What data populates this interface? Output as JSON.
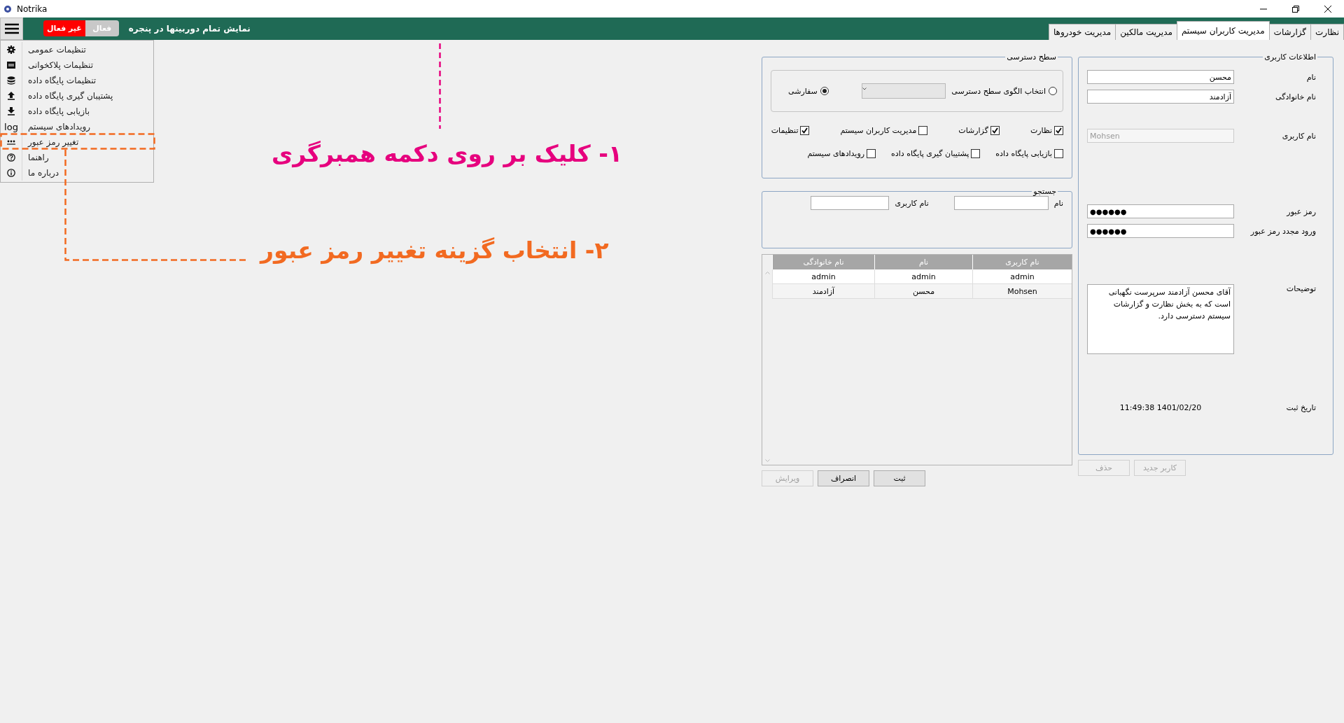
{
  "window": {
    "title": "Notrika"
  },
  "toolbar": {
    "toggle": [
      {
        "label": "فعال",
        "selected": false
      },
      {
        "label": "غیر فعال",
        "selected": true
      }
    ],
    "label": "نمایش تمام دوربینها در پنجره"
  },
  "tabs": [
    {
      "label": "نظارت",
      "selected": false
    },
    {
      "label": "گزارشات",
      "selected": false
    },
    {
      "label": "مدیریت کاربران سیستم",
      "selected": true
    },
    {
      "label": "مدیریت مالکین",
      "selected": false
    },
    {
      "label": "مدیریت خودروها",
      "selected": false
    }
  ],
  "menu": {
    "expanded": true,
    "items": [
      {
        "kind": "settings",
        "label": "تنظیمات عمومی"
      },
      {
        "kind": "plate",
        "label": "تنظیمات پلاکخوانی"
      },
      {
        "kind": "database",
        "label": "تنظیمات پایگاه داده"
      },
      {
        "kind": "upload",
        "label": "پشتیبان گیری پایگاه داده"
      },
      {
        "kind": "download",
        "label": "بازیابی پایگاه داده"
      },
      {
        "kind": "log",
        "icon_text": "log",
        "label": "رویدادهای سیستم"
      },
      {
        "kind": "password",
        "label": "تغییر رمز عبور"
      },
      {
        "kind": "help",
        "label": "راهنما"
      },
      {
        "kind": "info",
        "label": "درباره ما"
      }
    ]
  },
  "annotations": [
    {
      "text": "۱- کلیک بر روی دکمه همبرگری",
      "color": "#e6007e"
    },
    {
      "text": "۲- انتخاب گزینه تغییر رمز عبور",
      "color": "#f26a21"
    }
  ],
  "user_info": {
    "title": "اطلاعات کاربری",
    "fields": [
      {
        "kind": "text",
        "label": "نام",
        "value": "محسن"
      },
      {
        "kind": "text",
        "label": "نام خانوادگی",
        "value": "آزادمند"
      },
      {
        "kind": "text",
        "label": "نام کاربری",
        "value": "Mohsen",
        "disabled": true
      },
      {
        "kind": "text",
        "label": "رمز عبور",
        "value": "●●●●●●"
      },
      {
        "kind": "text",
        "label": "ورود مجدد رمز عبور",
        "value": "●●●●●●"
      },
      {
        "kind": "multiline",
        "label": "توضیحات",
        "value": "آقای محسن آزادمند سرپرست نگهبانی است که به بخش نظارت و گزارشات سیستم دسترسی دارد."
      },
      {
        "kind": "readonly",
        "label": "تاریخ ثبت",
        "value": "11:49:38 1401/02/20"
      }
    ],
    "buttons": [
      {
        "label": "کاربر جدید",
        "disabled": true
      },
      {
        "label": "حذف",
        "disabled": true
      }
    ]
  },
  "access": {
    "title": "سطح دسترسی",
    "modes": [
      {
        "label": "انتخاب الگوی سطح دسترسی",
        "selected": false
      },
      {
        "label": "سفارشی",
        "selected": true
      }
    ],
    "permission_rows": [
      [
        {
          "label": "نظارت",
          "checked": true
        },
        {
          "label": "گزارشات",
          "checked": true
        },
        {
          "label": "مدیریت کاربران سیستم",
          "checked": false
        },
        {
          "label": "تنظیمات",
          "checked": true
        }
      ],
      [
        {
          "label": "بازیابی پایگاه داده",
          "checked": false
        },
        {
          "label": "پشتیبان گیری پایگاه داده",
          "checked": false
        },
        {
          "label": "رویدادهای سیستم",
          "checked": false
        }
      ]
    ]
  },
  "search": {
    "title": "جستجو",
    "fields": [
      {
        "label": "نام"
      },
      {
        "label": "نام کاربری"
      }
    ]
  },
  "users_table": {
    "columns": [
      "نام کاربری",
      "نام",
      "نام خانوادگی"
    ],
    "rows": [
      [
        "admin",
        "admin",
        "admin"
      ],
      [
        "Mohsen",
        "محسن",
        "آزادمند"
      ]
    ]
  },
  "buttons": [
    {
      "label": "ثبت",
      "disabled": false
    },
    {
      "label": "انصراف",
      "disabled": false
    },
    {
      "label": "ویرایش",
      "disabled": true
    }
  ]
}
